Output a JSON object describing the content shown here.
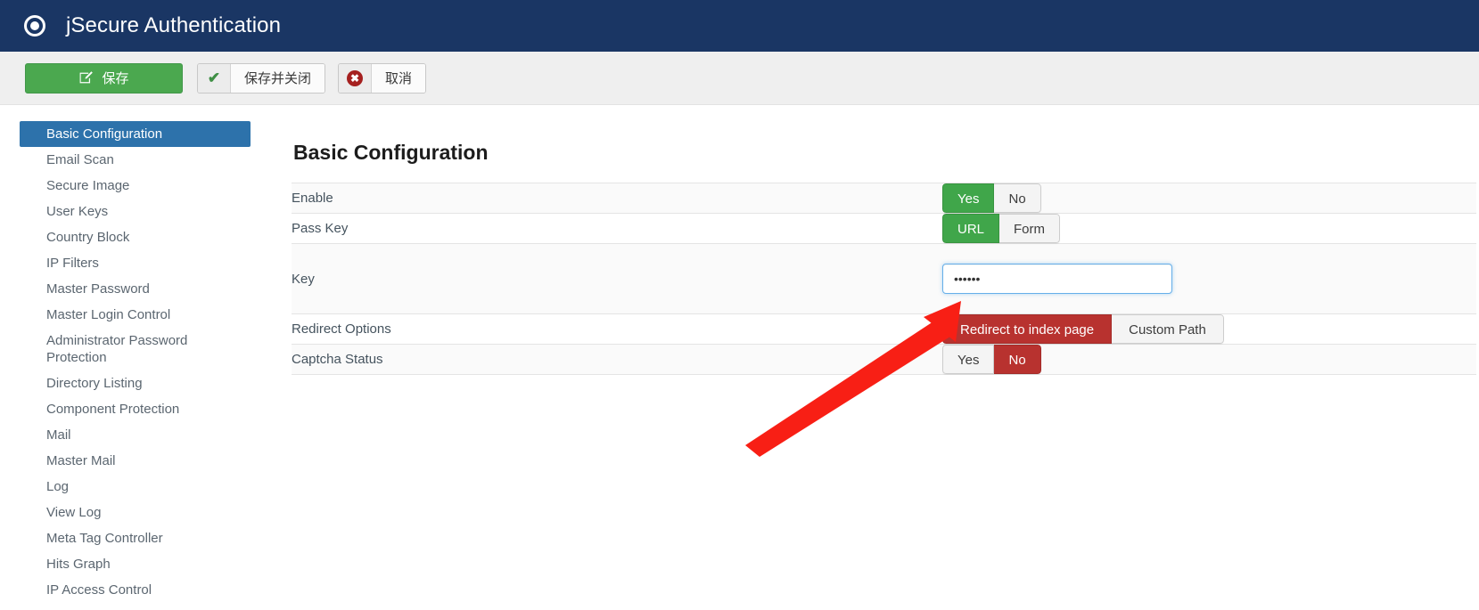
{
  "header": {
    "title": "jSecure Authentication",
    "icon": "target-record-icon",
    "background_color": "#1a3664"
  },
  "toolbar": {
    "save_label": "保存",
    "save_icon": "edit-pencil-icon",
    "save_close_label": "保存并关闭",
    "save_close_icon": "check-icon",
    "cancel_label": "取消",
    "cancel_icon": "close-circle-icon",
    "save_color": "#4ba84f"
  },
  "sidebar": {
    "active_color": "#2d72ab",
    "items": [
      {
        "label": "Basic Configuration",
        "active": true
      },
      {
        "label": "Email Scan",
        "active": false
      },
      {
        "label": "Secure Image",
        "active": false
      },
      {
        "label": "User Keys",
        "active": false
      },
      {
        "label": "Country Block",
        "active": false
      },
      {
        "label": "IP Filters",
        "active": false
      },
      {
        "label": "Master Password",
        "active": false
      },
      {
        "label": "Master Login Control",
        "active": false
      },
      {
        "label": "Administrator Password Protection",
        "active": false
      },
      {
        "label": "Directory Listing",
        "active": false
      },
      {
        "label": "Component Protection",
        "active": false
      },
      {
        "label": "Mail",
        "active": false
      },
      {
        "label": "Master Mail",
        "active": false
      },
      {
        "label": "Log",
        "active": false
      },
      {
        "label": "View Log",
        "active": false
      },
      {
        "label": "Meta Tag Controller",
        "active": false
      },
      {
        "label": "Hits Graph",
        "active": false
      },
      {
        "label": "IP Access Control",
        "active": false
      }
    ]
  },
  "main": {
    "heading": "Basic Configuration",
    "rows": [
      {
        "label": "Enable",
        "control": "toggle",
        "options": [
          {
            "label": "Yes",
            "state": "on-green"
          },
          {
            "label": "No",
            "state": "off"
          }
        ]
      },
      {
        "label": "Pass Key",
        "control": "toggle",
        "options": [
          {
            "label": "URL",
            "state": "on-green"
          },
          {
            "label": "Form",
            "state": "off"
          }
        ]
      },
      {
        "label": "Key",
        "control": "password",
        "value": "••••••",
        "placeholder": "",
        "focused": true
      },
      {
        "label": "Redirect Options",
        "control": "toggle",
        "options": [
          {
            "label": "Redirect to index page",
            "state": "on-red"
          },
          {
            "label": "Custom Path",
            "state": "off"
          }
        ]
      },
      {
        "label": "Captcha Status",
        "control": "toggle",
        "options": [
          {
            "label": "Yes",
            "state": "off"
          },
          {
            "label": "No",
            "state": "on-red"
          }
        ]
      }
    ]
  },
  "annotation": {
    "type": "arrow",
    "color": "#f81f15",
    "points_to": "key-input"
  }
}
